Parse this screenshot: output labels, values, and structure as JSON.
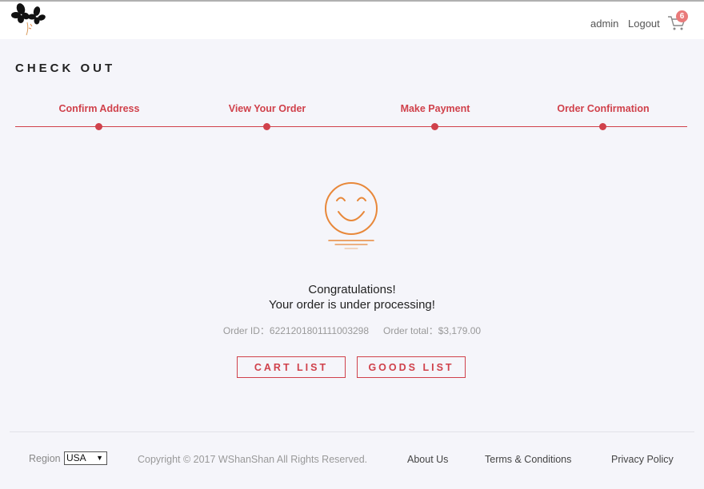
{
  "header": {
    "user": "admin",
    "logout_label": "Logout",
    "cart_count": "6"
  },
  "page": {
    "title": "CHECK OUT"
  },
  "steps": [
    {
      "label": "Confirm Address"
    },
    {
      "label": "View Your Order"
    },
    {
      "label": "Make Payment"
    },
    {
      "label": "Order Confirmation"
    }
  ],
  "result": {
    "line1": "Congratulations!",
    "line2": "Your order is under processing!",
    "order_id": "Order ID：6221201801111003298",
    "order_total": "Order total：$3,179.00"
  },
  "buttons": {
    "cart_list": "CART LIST",
    "goods_list": "GOODS LIST"
  },
  "footer": {
    "region_label": "Region",
    "region_value": "USA",
    "copyright": "Copyright © 2017 WShanShan All Rights Reserved.",
    "about": "About Us",
    "terms": "Terms & Conditions",
    "privacy": "Privacy Policy"
  },
  "colors": {
    "accent": "#d0414b",
    "smiley": "#e8883a",
    "badge": "#e97a7a",
    "background": "#f5f5fa"
  },
  "icons": [
    "flower-logo",
    "cart-icon",
    "smiley-icon",
    "select-arrow-icon"
  ]
}
